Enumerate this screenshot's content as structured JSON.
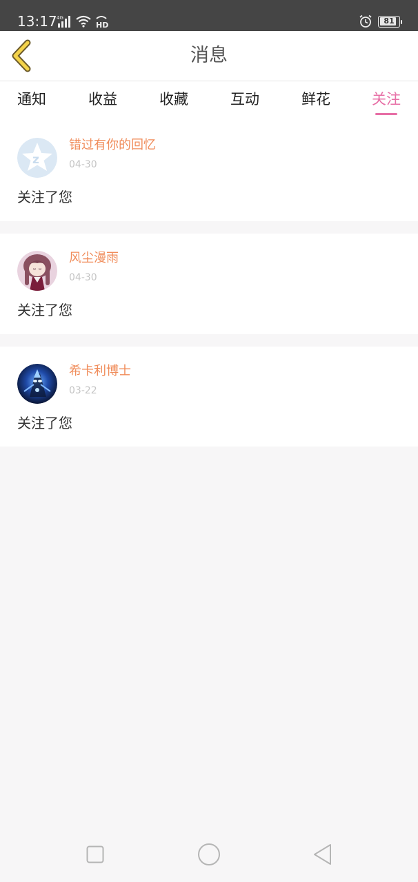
{
  "status_bar": {
    "time": "13:17",
    "network": "4G",
    "hd": "HD",
    "battery_level": 81,
    "battery_text": "81"
  },
  "header": {
    "title": "消息",
    "back_icon": "chevron-left-icon"
  },
  "tabs": [
    {
      "label": "通知",
      "active": false
    },
    {
      "label": "收益",
      "active": false
    },
    {
      "label": "收藏",
      "active": false
    },
    {
      "label": "互动",
      "active": false
    },
    {
      "label": "鲜花",
      "active": false
    },
    {
      "label": "关注",
      "active": true
    }
  ],
  "messages": [
    {
      "username": "错过有你的回忆",
      "date": "04-30",
      "text": "关注了您",
      "avatar": "default-qq-avatar"
    },
    {
      "username": "风尘漫雨",
      "date": "04-30",
      "text": "关注了您",
      "avatar": "anime-girl-avatar"
    },
    {
      "username": "希卡利博士",
      "date": "03-22",
      "text": "关注了您",
      "avatar": "ultraman-avatar"
    }
  ],
  "colors": {
    "accent": "#e76fa6",
    "username": "#f08c5a",
    "status_bar": "#454545",
    "background": "#f7f6f7"
  }
}
